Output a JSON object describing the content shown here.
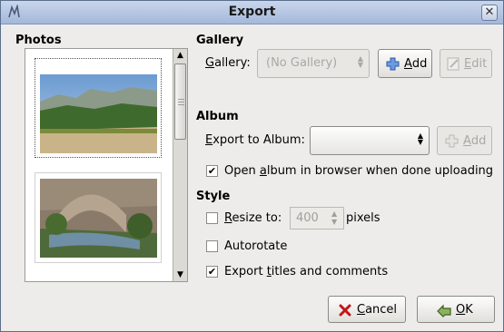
{
  "window": {
    "title": "Export"
  },
  "photos": {
    "heading": "Photos"
  },
  "gallery": {
    "heading": "Gallery",
    "label_pre": "",
    "label_u": "G",
    "label_post": "allery:",
    "value": "(No Gallery)",
    "add_u": "A",
    "add_post": "dd",
    "edit_u": "E",
    "edit_post": "dit"
  },
  "album": {
    "heading": "Album",
    "label_u": "E",
    "label_post": "xport to Album:",
    "value": "",
    "add_u": "A",
    "add_post": "dd",
    "open_pre": "Open ",
    "open_u": "a",
    "open_post": "lbum in browser when done uploading",
    "open_checked": true
  },
  "style": {
    "heading": "Style",
    "resize_u": "R",
    "resize_post": "esize to:",
    "resize_checked": false,
    "resize_value": "400",
    "resize_unit": "pixels",
    "autorotate": "Autorotate",
    "autorotate_checked": false,
    "titles_pre": "Export ",
    "titles_u": "t",
    "titles_post": "itles and comments",
    "titles_checked": true
  },
  "buttons": {
    "cancel_u": "C",
    "cancel_post": "ancel",
    "ok_u": "O",
    "ok_post": "K"
  },
  "colors": {
    "titlebar": "#b6c6e2",
    "window_bg": "#edeceb",
    "add_icon": "#3b6fc4",
    "cancel_icon": "#c0181b",
    "ok_icon": "#4a7a2a"
  }
}
